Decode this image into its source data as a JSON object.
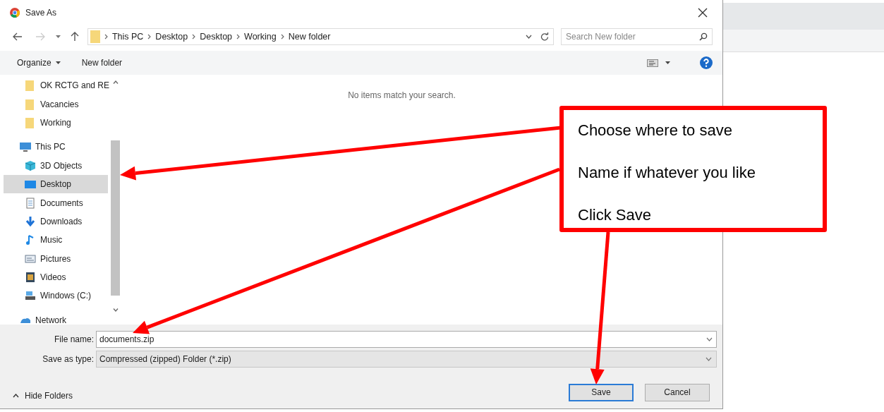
{
  "window": {
    "title": "Save As"
  },
  "address_bar": {
    "path": [
      "This PC",
      "Desktop",
      "Desktop",
      "Working",
      "New folder"
    ]
  },
  "search": {
    "placeholder": "Search New folder"
  },
  "toolbar": {
    "organize": "Organize",
    "new_folder": "New folder"
  },
  "nav_pane": {
    "pinned_folders": [
      {
        "label": "OK RCTG and RE",
        "kind": "folder",
        "selected": false
      },
      {
        "label": "Vacancies",
        "kind": "folder",
        "selected": false
      },
      {
        "label": "Working",
        "kind": "folder",
        "selected": false
      }
    ],
    "tree": [
      {
        "label": "This PC",
        "kind": "pc",
        "selected": false,
        "children": [
          {
            "label": "3D Objects",
            "kind": "cube",
            "selected": false
          },
          {
            "label": "Desktop",
            "kind": "desktop",
            "selected": true
          },
          {
            "label": "Documents",
            "kind": "document",
            "selected": false
          },
          {
            "label": "Downloads",
            "kind": "download",
            "selected": false
          },
          {
            "label": "Music",
            "kind": "music",
            "selected": false
          },
          {
            "label": "Pictures",
            "kind": "picture",
            "selected": false
          },
          {
            "label": "Videos",
            "kind": "video",
            "selected": false
          },
          {
            "label": "Windows (C:)",
            "kind": "drive",
            "selected": false
          }
        ]
      },
      {
        "label": "Network",
        "kind": "network",
        "selected": false
      }
    ]
  },
  "content": {
    "empty_message": "No items match your search."
  },
  "file_name": {
    "label": "File name:",
    "value": "documents.zip"
  },
  "save_as_type": {
    "label": "Save as type:",
    "value": "Compressed (zipped) Folder (*.zip)"
  },
  "hide_folders": "Hide Folders",
  "buttons": [
    {
      "label": "Save",
      "default": true
    },
    {
      "label": "Cancel",
      "default": false
    }
  ],
  "callout": {
    "lines": [
      "Choose where to save",
      "Name if whatever you like",
      "Click Save"
    ]
  }
}
